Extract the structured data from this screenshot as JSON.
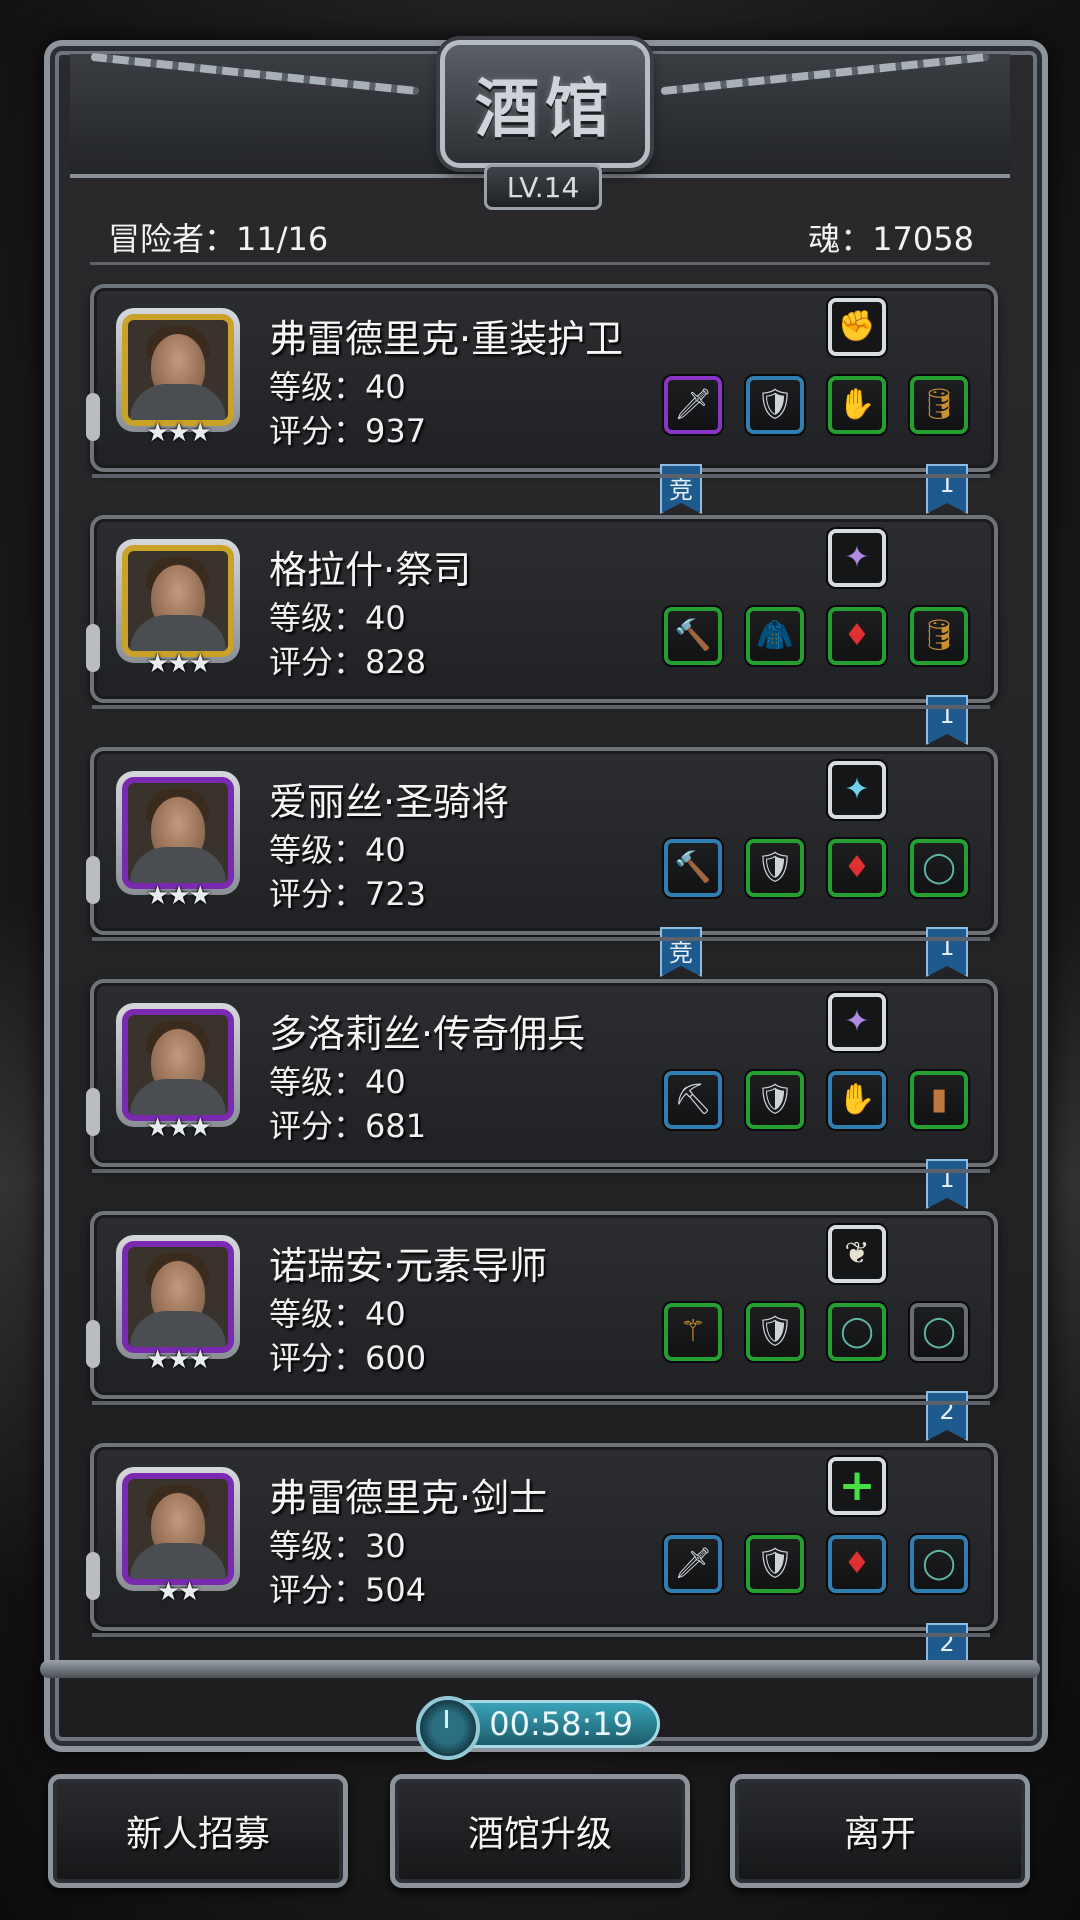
{
  "title": "酒馆",
  "level_badge": "LV.14",
  "stats": {
    "adventurers": "冒险者：11/16",
    "souls": "魂：17058"
  },
  "heroes": [
    {
      "name": "弗雷德里克·重装护卫",
      "level": "等级：40",
      "score": "评分：937",
      "stars": "★★★",
      "frame": "gold",
      "special": "gauntlet-icon",
      "gear": [
        [
          "sword-icon",
          "purple"
        ],
        [
          "chest-armor-icon",
          "blue"
        ],
        [
          "claw-gauntlet-icon",
          "green"
        ],
        [
          "barrel-icon",
          "green"
        ]
      ],
      "flags": [
        [
          "竞",
          "left"
        ],
        [
          "1",
          "right"
        ]
      ]
    },
    {
      "name": "格拉什·祭司",
      "level": "等级：40",
      "score": "评分：828",
      "stars": "★★★",
      "frame": "gold",
      "special": "purple-crystal-icon",
      "gear": [
        [
          "hammer-icon",
          "green"
        ],
        [
          "leather-armor-icon",
          "green"
        ],
        [
          "ruby-amulet-icon",
          "green"
        ],
        [
          "barrel-icon",
          "green"
        ]
      ],
      "flags": [
        [
          "1",
          "right"
        ]
      ]
    },
    {
      "name": "爱丽丝·圣骑将",
      "level": "等级：40",
      "score": "评分：723",
      "stars": "★★★",
      "frame": "purple",
      "special": "blue-crystal-icon",
      "gear": [
        [
          "hammer-icon",
          "blue"
        ],
        [
          "plate-armor-icon",
          "green"
        ],
        [
          "ruby-amulet-icon",
          "green"
        ],
        [
          "ring-icon",
          "green"
        ]
      ],
      "flags": [
        [
          "竞",
          "left"
        ],
        [
          "1",
          "right"
        ]
      ]
    },
    {
      "name": "多洛莉丝·传奇佣兵",
      "level": "等级：40",
      "score": "评分：681",
      "stars": "★★★",
      "frame": "purple",
      "special": "purple-crystal-icon",
      "gear": [
        [
          "pickaxe-icon",
          "blue"
        ],
        [
          "chest-armor-icon",
          "green"
        ],
        [
          "claw-gauntlet-icon",
          "blue"
        ],
        [
          "wood-plank-icon",
          "green"
        ]
      ],
      "flags": [
        [
          "1",
          "right"
        ]
      ]
    },
    {
      "name": "诺瑞安·元素导师",
      "level": "等级：40",
      "score": "评分：600",
      "stars": "★★★",
      "frame": "purple",
      "special": "feather-icon",
      "gear": [
        [
          "staff-icon",
          "green"
        ],
        [
          "chest-armor-icon",
          "green"
        ],
        [
          "ring-icon",
          "green"
        ],
        [
          "ring-icon",
          "gray"
        ]
      ],
      "flags": [
        [
          "2",
          "right"
        ]
      ]
    },
    {
      "name": "弗雷德里克·剑士",
      "level": "等级：30",
      "score": "评分：504",
      "stars": "★★",
      "frame": "purple",
      "special": "add-plus-icon",
      "gear": [
        [
          "sword-icon",
          "blue"
        ],
        [
          "chest-armor-icon",
          "green"
        ],
        [
          "ruby-amulet-icon",
          "blue"
        ],
        [
          "ring-icon",
          "blue"
        ]
      ],
      "flags": [
        [
          "2",
          "right"
        ]
      ]
    }
  ],
  "timer": "00:58:19",
  "buttons": {
    "recruit": "新人招募",
    "upgrade": "酒馆升级",
    "leave": "离开"
  },
  "colors": {
    "gold": "#c9a227",
    "purple": "#7a2ab0",
    "green": "#24a030",
    "blue": "#2f7fb0",
    "flag": "#1f5a8e"
  }
}
